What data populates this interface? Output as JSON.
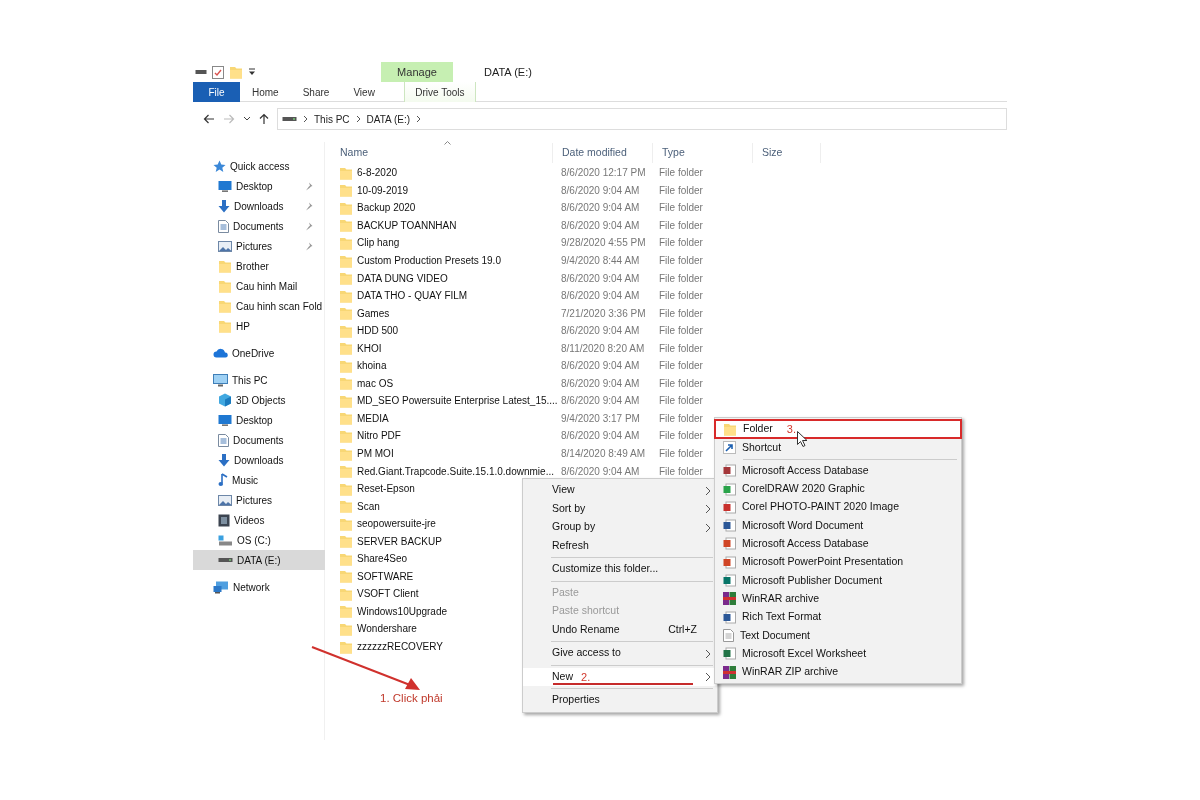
{
  "window": {
    "title": "DATA (E:)"
  },
  "ribbon": {
    "context_group": "Manage",
    "tabs": [
      {
        "label": "File",
        "kind": "file",
        "selected": false
      },
      {
        "label": "Home",
        "kind": "tab",
        "selected": false
      },
      {
        "label": "Share",
        "kind": "tab",
        "selected": false
      },
      {
        "label": "View",
        "kind": "tab",
        "selected": false
      },
      {
        "label": "Drive Tools",
        "kind": "context",
        "selected": false
      }
    ]
  },
  "address": {
    "crumbs": [
      "This PC",
      "DATA (E:)"
    ]
  },
  "sidebar": {
    "groups": [
      {
        "label": "Quick access",
        "kind": "star",
        "selected": false,
        "children": [
          {
            "label": "Desktop",
            "kind": "desktop",
            "pinned": true,
            "selected": false
          },
          {
            "label": "Downloads",
            "kind": "download",
            "pinned": true,
            "selected": false
          },
          {
            "label": "Documents",
            "kind": "document",
            "pinned": true,
            "selected": false
          },
          {
            "label": "Pictures",
            "kind": "picture",
            "pinned": true,
            "selected": false
          },
          {
            "label": "Brother",
            "kind": "folder",
            "pinned": false,
            "selected": false
          },
          {
            "label": "Cau hinh Mail",
            "kind": "folder",
            "pinned": false,
            "selected": false
          },
          {
            "label": "Cau hinh scan Fold",
            "kind": "folder",
            "pinned": false,
            "selected": false
          },
          {
            "label": "HP",
            "kind": "folder",
            "pinned": false,
            "selected": false
          }
        ]
      },
      {
        "label": "OneDrive",
        "kind": "cloud",
        "selected": false
      },
      {
        "label": "This PC",
        "kind": "pc",
        "selected": false,
        "children": [
          {
            "label": "3D Objects",
            "kind": "cube",
            "pinned": false,
            "selected": false
          },
          {
            "label": "Desktop",
            "kind": "desktop",
            "pinned": false,
            "selected": false
          },
          {
            "label": "Documents",
            "kind": "document",
            "pinned": false,
            "selected": false
          },
          {
            "label": "Downloads",
            "kind": "download",
            "pinned": false,
            "selected": false
          },
          {
            "label": "Music",
            "kind": "music",
            "pinned": false,
            "selected": false
          },
          {
            "label": "Pictures",
            "kind": "picture",
            "pinned": false,
            "selected": false
          },
          {
            "label": "Videos",
            "kind": "video",
            "pinned": false,
            "selected": false
          },
          {
            "label": "OS (C:)",
            "kind": "drive-c",
            "pinned": false,
            "selected": false
          },
          {
            "label": "DATA (E:)",
            "kind": "drive",
            "pinned": false,
            "selected": true
          }
        ]
      },
      {
        "label": "Network",
        "kind": "network",
        "selected": false
      }
    ]
  },
  "table": {
    "columns": [
      "Name",
      "Date modified",
      "Type",
      "Size"
    ],
    "rows": [
      {
        "name": "6-8-2020",
        "date": "8/6/2020 12:17 PM",
        "type": "File folder"
      },
      {
        "name": "10-09-2019",
        "date": "8/6/2020 9:04 AM",
        "type": "File folder"
      },
      {
        "name": "Backup 2020",
        "date": "8/6/2020 9:04 AM",
        "type": "File folder"
      },
      {
        "name": "BACKUP TOANNHAN",
        "date": "8/6/2020 9:04 AM",
        "type": "File folder"
      },
      {
        "name": "Clip hang",
        "date": "9/28/2020 4:55 PM",
        "type": "File folder"
      },
      {
        "name": "Custom Production Presets 19.0",
        "date": "9/4/2020 8:44 AM",
        "type": "File folder"
      },
      {
        "name": "DATA DUNG VIDEO",
        "date": "8/6/2020 9:04 AM",
        "type": "File folder"
      },
      {
        "name": "DATA THO - QUAY FILM",
        "date": "8/6/2020 9:04 AM",
        "type": "File folder"
      },
      {
        "name": "Games",
        "date": "7/21/2020 3:36 PM",
        "type": "File folder"
      },
      {
        "name": "HDD 500",
        "date": "8/6/2020 9:04 AM",
        "type": "File folder"
      },
      {
        "name": "KHOI",
        "date": "8/11/2020 8:20 AM",
        "type": "File folder"
      },
      {
        "name": "khoina",
        "date": "8/6/2020 9:04 AM",
        "type": "File folder"
      },
      {
        "name": "mac OS",
        "date": "8/6/2020 9:04 AM",
        "type": "File folder"
      },
      {
        "name": "MD_SEO Powersuite Enterprise Latest_15....",
        "date": "8/6/2020 9:04 AM",
        "type": "File folder"
      },
      {
        "name": "MEDIA",
        "date": "9/4/2020 3:17 PM",
        "type": "File folder"
      },
      {
        "name": "Nitro PDF",
        "date": "8/6/2020 9:04 AM",
        "type": "File folder"
      },
      {
        "name": "PM MOI",
        "date": "8/14/2020 8:49 AM",
        "type": "File folder"
      },
      {
        "name": "Red.Giant.Trapcode.Suite.15.1.0.downmie...",
        "date": "8/6/2020 9:04 AM",
        "type": "File folder"
      },
      {
        "name": "Reset-Epson"
      },
      {
        "name": "Scan"
      },
      {
        "name": "seopowersuite-jre"
      },
      {
        "name": "SERVER BACKUP"
      },
      {
        "name": "Share4Seo"
      },
      {
        "name": "SOFTWARE"
      },
      {
        "name": "VSOFT Client"
      },
      {
        "name": "Windows10Upgrade"
      },
      {
        "name": "Wondershare"
      },
      {
        "name": "zzzzzzRECOVERY"
      }
    ]
  },
  "context_menu": {
    "items": [
      {
        "kind": "item",
        "label": "View",
        "submenu": true,
        "disabled": false,
        "selected": false
      },
      {
        "kind": "item",
        "label": "Sort by",
        "submenu": true,
        "disabled": false,
        "selected": false
      },
      {
        "kind": "item",
        "label": "Group by",
        "submenu": true,
        "disabled": false,
        "selected": false
      },
      {
        "kind": "item",
        "label": "Refresh",
        "submenu": false,
        "disabled": false,
        "selected": false
      },
      {
        "kind": "separator"
      },
      {
        "kind": "item",
        "label": "Customize this folder...",
        "submenu": false,
        "disabled": false,
        "selected": false
      },
      {
        "kind": "separator"
      },
      {
        "kind": "item",
        "label": "Paste",
        "submenu": false,
        "disabled": true,
        "selected": false
      },
      {
        "kind": "item",
        "label": "Paste shortcut",
        "submenu": false,
        "disabled": true,
        "selected": false
      },
      {
        "kind": "item",
        "label": "Undo Rename",
        "shortcut": "Ctrl+Z",
        "submenu": false,
        "disabled": false,
        "selected": false
      },
      {
        "kind": "separator"
      },
      {
        "kind": "item",
        "label": "Give access to",
        "submenu": true,
        "disabled": false,
        "selected": false
      },
      {
        "kind": "separator"
      },
      {
        "kind": "item",
        "label": "New",
        "submenu": true,
        "disabled": false,
        "selected": true,
        "note": "2."
      },
      {
        "kind": "separator"
      },
      {
        "kind": "item",
        "label": "Properties",
        "submenu": false,
        "disabled": false,
        "selected": false
      }
    ]
  },
  "new_submenu": {
    "items": [
      {
        "kind": "folder",
        "label": "Folder",
        "selected": true,
        "note": "3."
      },
      {
        "kind": "shortcut",
        "label": "Shortcut",
        "selected": false
      },
      {
        "kind": "separator"
      },
      {
        "kind": "access",
        "label": "Microsoft Access Database",
        "selected": false
      },
      {
        "kind": "coreldraw",
        "label": "CorelDRAW 2020 Graphic",
        "selected": false
      },
      {
        "kind": "photopaint",
        "label": "Corel PHOTO-PAINT 2020 Image",
        "selected": false
      },
      {
        "kind": "word",
        "label": "Microsoft Word Document",
        "selected": false
      },
      {
        "kind": "powerpoint",
        "label": "Microsoft Access Database",
        "selected": false
      },
      {
        "kind": "powerpoint",
        "label": "Microsoft PowerPoint Presentation",
        "selected": false
      },
      {
        "kind": "publisher",
        "label": "Microsoft Publisher Document",
        "selected": false
      },
      {
        "kind": "winrar",
        "label": "WinRAR archive",
        "selected": false
      },
      {
        "kind": "word",
        "label": "Rich Text Format",
        "selected": false
      },
      {
        "kind": "text",
        "label": "Text Document",
        "selected": false
      },
      {
        "kind": "excel",
        "label": "Microsoft Excel Worksheet",
        "selected": false
      },
      {
        "kind": "winrar",
        "label": "WinRAR ZIP archive",
        "selected": false
      }
    ]
  },
  "annotation": {
    "label": "1. Click phải"
  }
}
